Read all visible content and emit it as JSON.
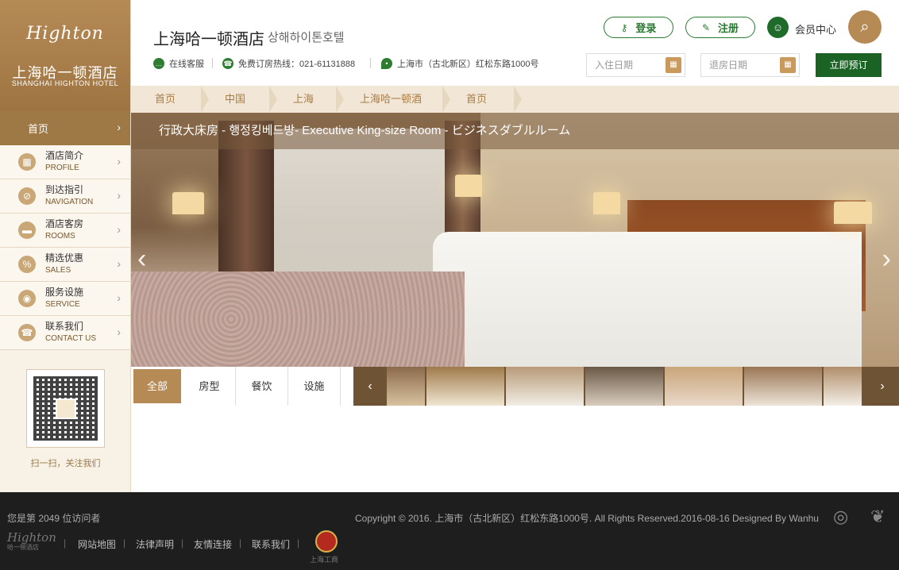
{
  "sidebar": {
    "logo": {
      "mark": "Highton",
      "cn": "上海哈一顿酒店",
      "en": "SHANGHAI HIGHTON HOTEL"
    },
    "home_label": "首页",
    "items": [
      {
        "cn": "酒店简介",
        "en": "PROFILE",
        "icon": "building-icon"
      },
      {
        "cn": "到达指引",
        "en": "NAVIGATION",
        "icon": "compass-icon"
      },
      {
        "cn": "酒店客房",
        "en": "ROOMS",
        "icon": "bed-icon"
      },
      {
        "cn": "精选优惠",
        "en": "SALES",
        "icon": "discount-icon"
      },
      {
        "cn": "服务设施",
        "en": "SERVICE",
        "icon": "concierge-icon"
      },
      {
        "cn": "联系我们",
        "en": "CONTACT US",
        "icon": "phone-icon"
      }
    ],
    "qr_caption": "扫一扫，关注我们"
  },
  "header": {
    "hotel_name": "上海哈一顿酒店",
    "hotel_name_kr": "상해하이톤호텔",
    "online_service": "在线客服",
    "hotline": "免费订房热线：021-61131888",
    "address": "上海市（古北新区）红松东路1000号",
    "login_label": "登录",
    "register_label": "注册",
    "member_label": "会员中心",
    "checkin_placeholder": "入住日期",
    "checkout_placeholder": "退房日期",
    "book_label": "立即预订"
  },
  "breadcrumb": [
    "首页",
    "中国",
    "上海",
    "上海哈一顿酒店",
    "首页"
  ],
  "hero": {
    "title": "行政大床房 - 행정킹베드방- Executive King-size  Room - ビジネスダブルルーム"
  },
  "tabs": [
    "全部",
    "房型",
    "餐饮",
    "设施"
  ],
  "footer": {
    "visitor": "您是第 2049 位访问者",
    "copyright": "Copyright © 2016. 上海市（古北新区）红松东路1000号. All Rights Reserved.2016-08-16 Designed By Wanhu",
    "links": [
      "网站地图",
      "法律声明",
      "友情连接",
      "联系我们"
    ],
    "logo_mark": "Highton",
    "logo_sub": "哈一顿酒店",
    "badge_text": "上海工商"
  },
  "colors": {
    "brand_gold": "#b58a55",
    "brand_green": "#1a6324",
    "footer_bg": "#1e1e1e"
  }
}
